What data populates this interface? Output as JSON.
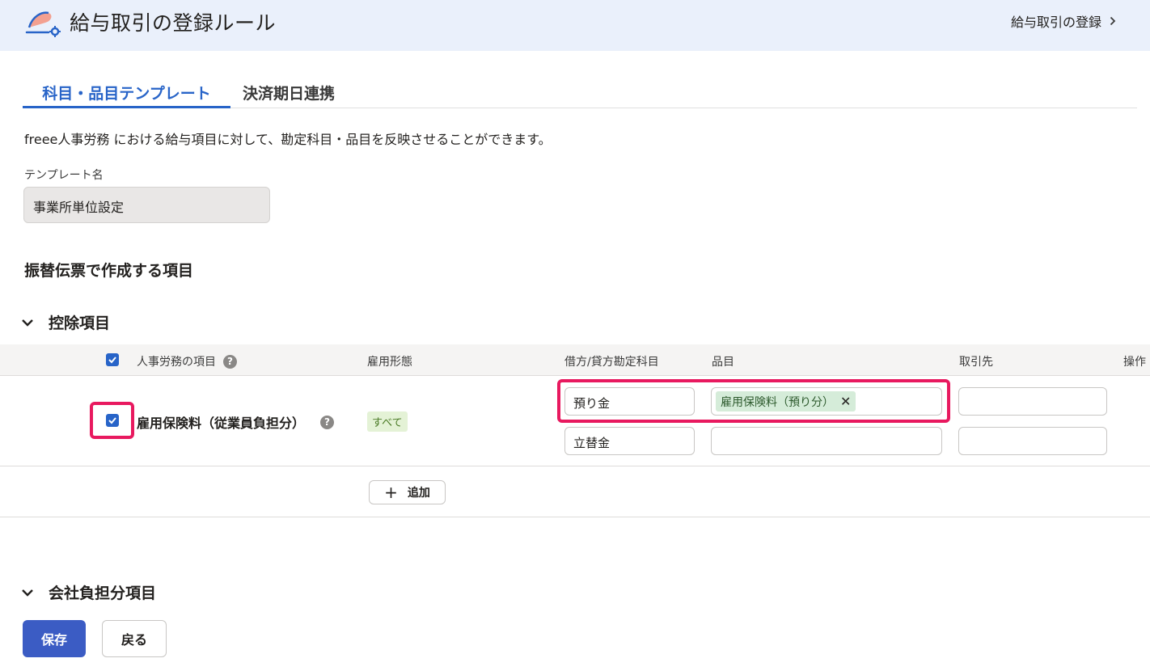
{
  "header": {
    "title": "給与取引の登録ルール",
    "nav_link": "給与取引の登録",
    "logo_icon": "payroll-settings-icon"
  },
  "tabs": [
    {
      "label": "科目・品目テンプレート",
      "active": true
    },
    {
      "label": "決済期日連携",
      "active": false
    }
  ],
  "description": "freee人事労務 における給与項目に対して、勘定科目・品目を反映させることができます。",
  "template": {
    "label": "テンプレート名",
    "value": "事業所単位設定"
  },
  "section_title": "振替伝票で作成する項目",
  "deduction_group": {
    "title": "控除項目",
    "expanded": true,
    "columns": {
      "item": "人事労務の項目",
      "employment": "雇用形態",
      "account": "借方/貸方勘定科目",
      "product": "品目",
      "partner": "取引先",
      "actions": "操作"
    },
    "header_checked": true,
    "rows": [
      {
        "checked": true,
        "name": "雇用保険料（従業員負担分）",
        "employment_badge": "すべて",
        "debit_account": "預り金",
        "debit_product_tag": "雇用保険料（預り分）",
        "debit_partner": "",
        "credit_account": "立替金",
        "credit_product": "",
        "credit_partner": ""
      }
    ],
    "add_button": "追加"
  },
  "company_group": {
    "title": "会社負担分項目",
    "expanded": false
  },
  "buttons": {
    "save": "保存",
    "back": "戻る"
  },
  "colors": {
    "primary": "#3b5cc4",
    "tab_active": "#2864c8",
    "highlight": "#e8195f",
    "header_bg": "#eaf0fb",
    "tag_bg": "#d5ecd9",
    "badge_bg": "#e4f2d6"
  }
}
